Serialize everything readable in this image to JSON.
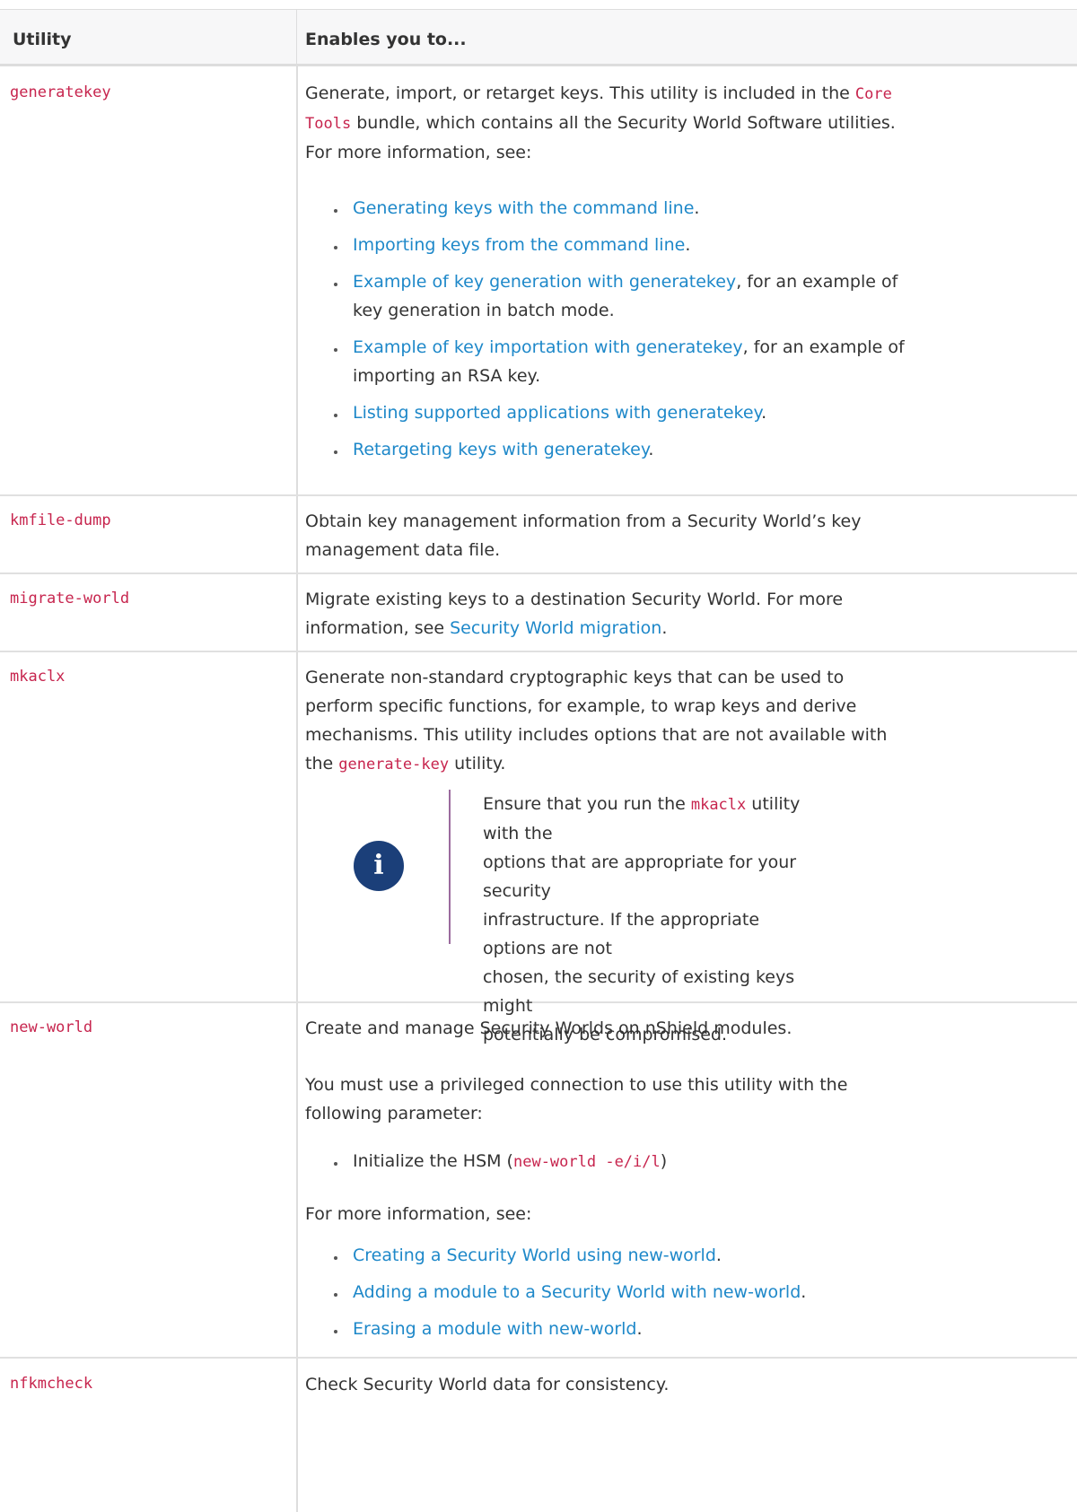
{
  "table": {
    "header": {
      "col1": "Utility",
      "col2": "Enables you to..."
    },
    "generatekey": {
      "name": "generatekey",
      "line1": "Generate, import, or retarget keys. This utility is included in the",
      "code1": "Core",
      "code2": "Tools",
      "line2": " bundle, which contains all the Security World Software utilities.",
      "line3": "For more information, see:",
      "bullets": [
        {
          "link": "Generating keys with the command line",
          "rest": "."
        },
        {
          "link": "Importing keys from the command line",
          "rest": "."
        },
        {
          "link": "Example of key generation with generatekey",
          "rest": ", for an example of",
          "rest2": "key generation in batch mode."
        },
        {
          "link": "Example of key importation with generatekey",
          "rest": ", for an example of",
          "rest2": "importing an RSA key."
        },
        {
          "link": "Listing supported applications with generatekey",
          "rest": "."
        },
        {
          "link": "Retargeting keys with generatekey",
          "rest": "."
        }
      ]
    },
    "kmfile": {
      "name": "kmfile-dump",
      "line1": "Obtain key management information from a Security World’s key",
      "line2": "management data file."
    },
    "migrate": {
      "name": "migrate-world",
      "line1": "Migrate existing keys to a destination Security World. For more",
      "line2a": "information, see ",
      "link": "Security World migration",
      "line2b": "."
    },
    "mkaclx": {
      "name": "mkaclx",
      "line1": "Generate non-standard cryptographic keys that can be used to",
      "line2": "perform specific functions, for example, to wrap keys and derive",
      "line3": "mechanisms. This utility includes options that are not available with",
      "line4a": "the ",
      "line4code": "generate-key",
      "line4b": " utility.",
      "note": {
        "icon": "i",
        "l1a": "Ensure that you run the ",
        "l1code": "mkaclx",
        "l1b": " utility with the",
        "l2": "options that are appropriate for your security",
        "l3": "infrastructure. If the appropriate options are not",
        "l4": "chosen, the security of existing keys might",
        "l5": "potentially be compromised."
      }
    },
    "newworld": {
      "name": "new-world",
      "p1": "Create and manage Security Worlds on nShield modules.",
      "p2l1": "You must use a privileged connection to use this utility with the",
      "p2l2": "following parameter:",
      "b1a": "Initialize the HSM (",
      "b1code": "new-world -e/i/l",
      "b1b": ")",
      "p3": "For more information, see:",
      "bullets": [
        {
          "link": "Creating a Security World using new-world",
          "rest": "."
        },
        {
          "link": "Adding a module to a Security World with new-world",
          "rest": "."
        },
        {
          "link": "Erasing a module with new-world",
          "rest": "."
        }
      ]
    },
    "nfkmcheck": {
      "name": "nfkmcheck",
      "desc": "Check Security World data for consistency."
    }
  }
}
